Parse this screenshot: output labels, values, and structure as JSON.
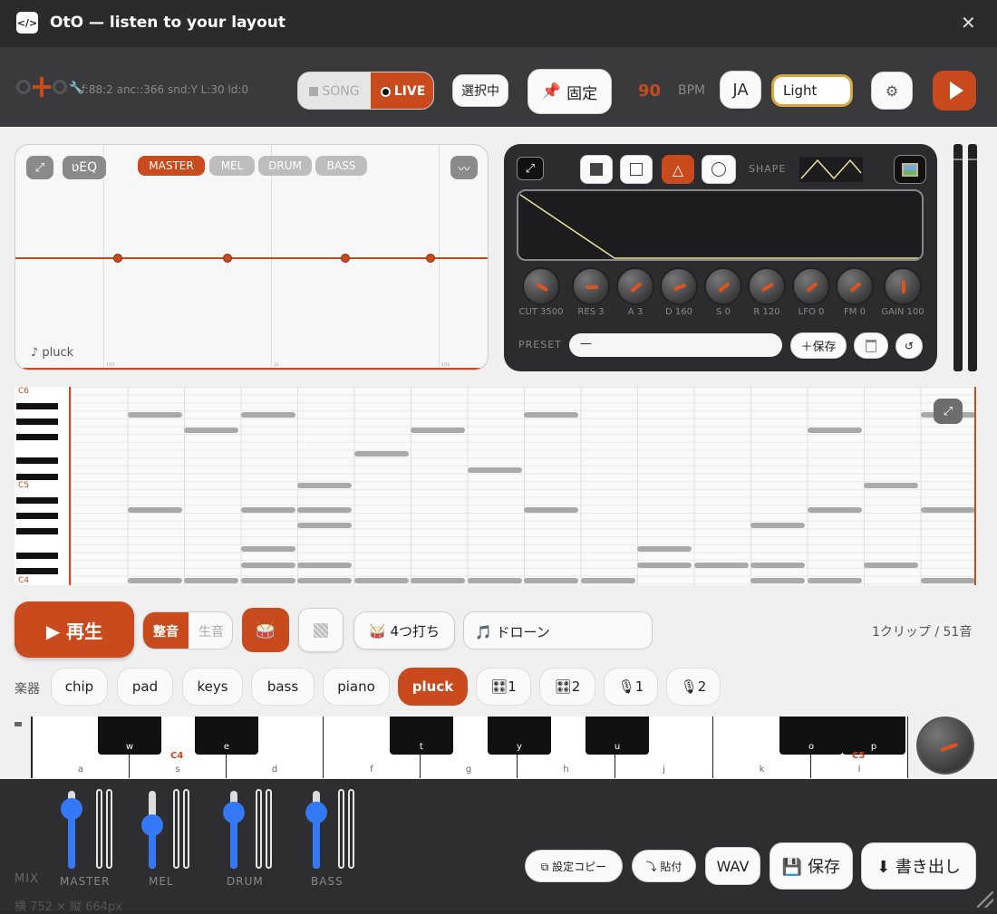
{
  "window": {
    "title": "OtO — listen to your layout",
    "app_icon": "code-icon",
    "close": "✕"
  },
  "toolbar": {
    "logo": "oto",
    "debug": "f:88:2 anc::366 snd:Y L:30 ld:0",
    "mode_song": "SONG",
    "mode_live": "LIVE",
    "selecting": "選択中",
    "pin": "固定",
    "bpm_value": "90",
    "bpm_label": "BPM",
    "lang": "JA",
    "theme": "Light",
    "settings_icon": "gear-icon",
    "play_icon": "play-icon"
  },
  "eq": {
    "expand": "⤢",
    "ueq": "ʋEQ",
    "tabs": [
      "MASTER",
      "MEL",
      "DRUM",
      "BASS"
    ],
    "active_tab": "MASTER",
    "wave": "〰",
    "instrument": "♪ pluck",
    "freq_ticks": [
      "100",
      "1k",
      "10k"
    ],
    "band_points": [
      1,
      2,
      3,
      4
    ]
  },
  "synth": {
    "expand": "⤢",
    "shapes": [
      "square-filled",
      "square",
      "triangle",
      "circle"
    ],
    "active_shape": "triangle",
    "shape_label": "SHAPE",
    "image_icon": "image-icon",
    "knobs": [
      "CUT 3500",
      "RES 3",
      "A 3",
      "D 160",
      "S 0",
      "R 120",
      "LFO 0",
      "FM 0",
      "GAIN 100"
    ],
    "preset_label": "PRESET",
    "preset_value": "—",
    "save": "＋保存",
    "trash_icon": "trash-icon",
    "reset": "↺"
  },
  "roll": {
    "labels": [
      "C6",
      "C5",
      "C4"
    ],
    "expand": "⤢"
  },
  "transport": {
    "play": "▶ 再生",
    "seion": "整音",
    "namaon": "生音",
    "drum_icon": "drum-icon",
    "blank_icon": "pattern-icon",
    "four": "🥁 4つ打ち",
    "drone": "🎵 ドローン",
    "status": "1クリップ / 51音"
  },
  "instruments": {
    "label": "楽器",
    "items": [
      "chip",
      "pad",
      "keys",
      "bass",
      "piano",
      "pluck",
      "🎛1",
      "🎛2",
      "🎙1",
      "🎙2"
    ],
    "active": "pluck"
  },
  "keyboard": {
    "white": [
      "a",
      "s",
      "d",
      "f",
      "g",
      "h",
      "j",
      "k",
      "l"
    ],
    "black": [
      "w",
      "e",
      "t",
      "y",
      "u",
      "o",
      "p"
    ],
    "c4": "C4",
    "c5": "C5"
  },
  "mix": {
    "label": "MIX",
    "channels": [
      {
        "name": "MASTER",
        "level": 0.78
      },
      {
        "name": "MEL",
        "level": 0.55
      },
      {
        "name": "DRUM",
        "level": 0.72
      },
      {
        "name": "BASS",
        "level": 0.72
      }
    ],
    "copy_settings": "⧉ 設定コピー",
    "paste": "⤵ 貼付",
    "wav": "WAV",
    "save": "💾 保存",
    "export": "⬇ 書き出し",
    "size": "横 752 × 縦 664px"
  },
  "colors": {
    "accent": "#c94a1c",
    "fader": "#3478f6",
    "dark_panel": "#2c2c2e"
  }
}
